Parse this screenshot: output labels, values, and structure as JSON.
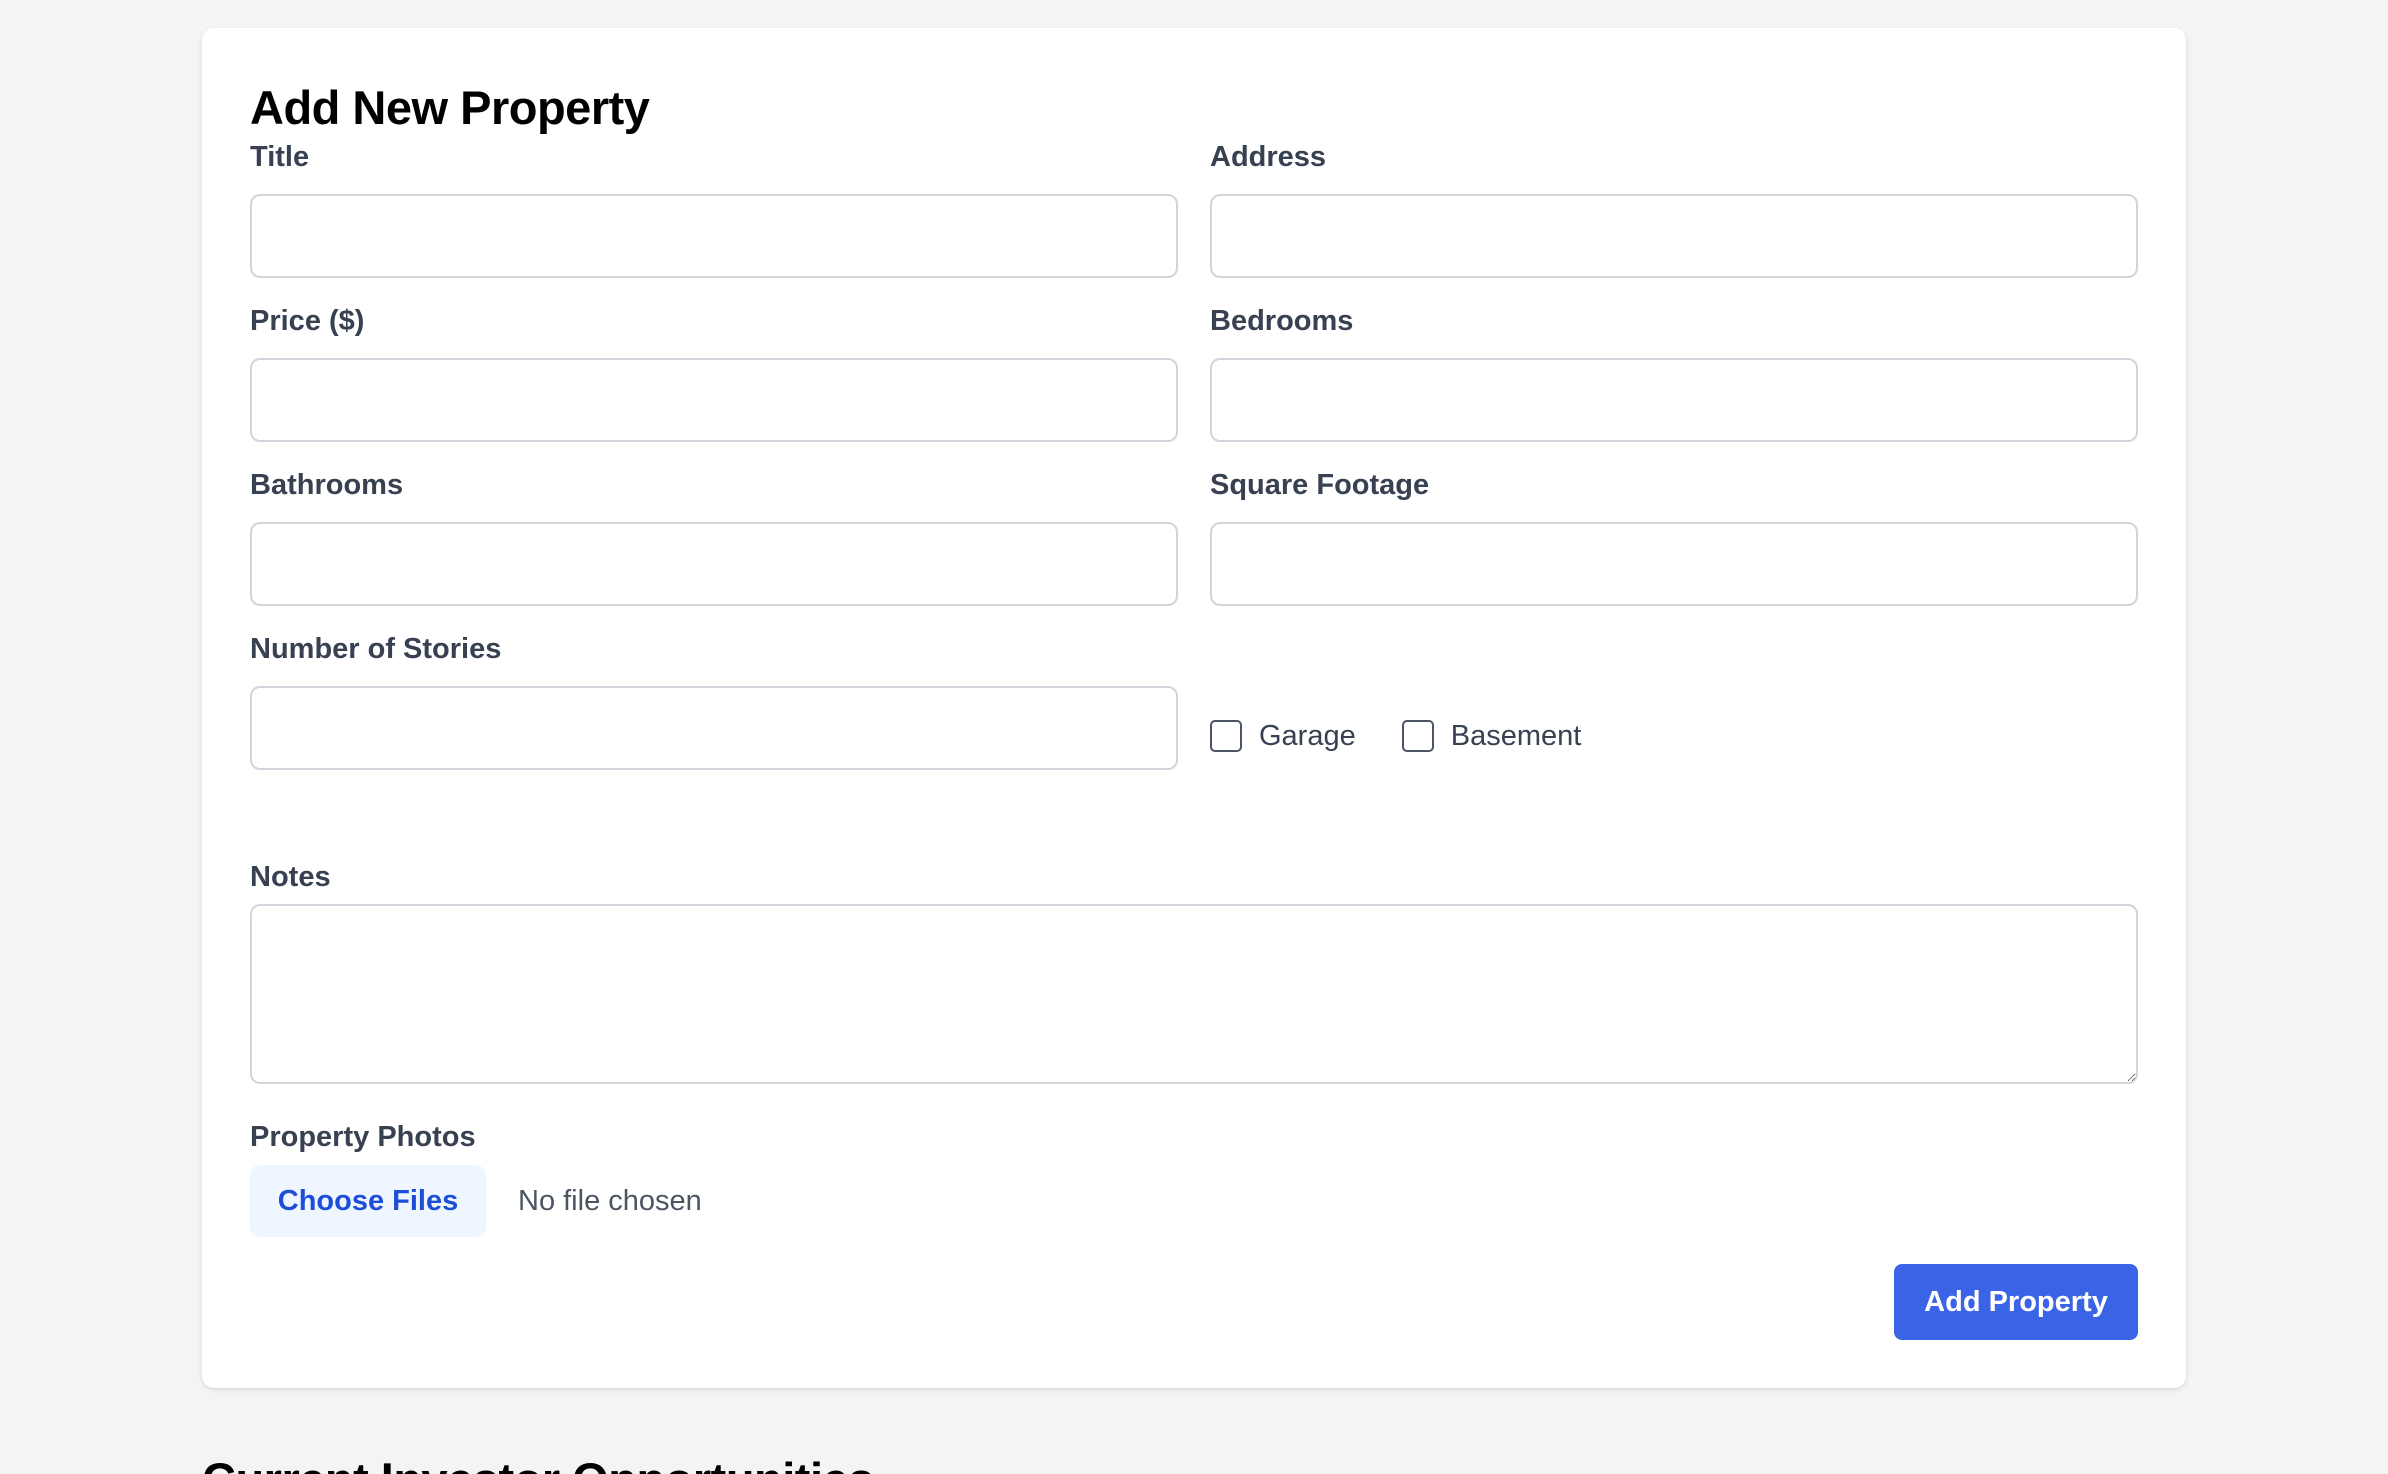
{
  "form": {
    "title": "Add New Property",
    "fields": {
      "title": {
        "label": "Title",
        "value": "",
        "placeholder": ""
      },
      "address": {
        "label": "Address",
        "value": "",
        "placeholder": ""
      },
      "price": {
        "label": "Price ($)",
        "value": "",
        "placeholder": ""
      },
      "bedrooms": {
        "label": "Bedrooms",
        "value": "",
        "placeholder": ""
      },
      "bathrooms": {
        "label": "Bathrooms",
        "value": "",
        "placeholder": ""
      },
      "square_footage": {
        "label": "Square Footage",
        "value": "",
        "placeholder": ""
      },
      "stories": {
        "label": "Number of Stories",
        "value": "",
        "placeholder": ""
      },
      "notes": {
        "label": "Notes",
        "value": "",
        "placeholder": ""
      }
    },
    "checkboxes": {
      "garage": {
        "label": "Garage",
        "checked": false
      },
      "basement": {
        "label": "Basement",
        "checked": false
      }
    },
    "photos": {
      "label": "Property Photos",
      "button_label": "Choose Files",
      "status": "No file chosen"
    },
    "submit_label": "Add Property"
  },
  "next_section": {
    "heading": "Current Investor Opportunities"
  },
  "colors": {
    "page_background": "#f3f4f6",
    "card_background": "#ffffff",
    "primary": "#3b63e6",
    "file_button_bg": "#eff6ff",
    "file_button_text": "#1d4ed8"
  }
}
